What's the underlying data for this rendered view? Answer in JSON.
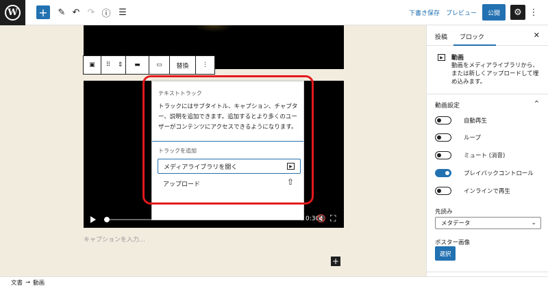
{
  "topbar": {
    "logo": "W",
    "icons": [
      "plus-icon",
      "pencil-icon",
      "undo-icon",
      "redo-icon",
      "info-icon",
      "list-view-icon",
      "gear-icon",
      "more-vertical-icon"
    ],
    "save_draft": "下書き保存",
    "preview": "プレビュー",
    "publish": "公開"
  },
  "block_toolbar": {
    "replace_label": "替換"
  },
  "video": {
    "time": "0:00 / 0:30"
  },
  "popover": {
    "heading": "テキストトラック",
    "description": "トラックにはサブタイトル、キャプション、チャプター、説明を追加できます。追加するとより多くのユーザーがコンテンツにアクセスできるようになります。",
    "add_track_label": "トラックを追加",
    "open_library": "メディアライブラリを開く",
    "upload": "アップロード"
  },
  "caption_placeholder": "キャプションを入力…",
  "sidebar": {
    "tabs": [
      "投稿",
      "ブロック"
    ],
    "active_tab": "ブロック",
    "block_name": "動画",
    "block_description": "動画をメディアライブラリから、または新しくアップロードして埋め込みます。",
    "panel_title": "動画設定",
    "toggles": [
      {
        "label": "自動再生",
        "on": false
      },
      {
        "label": "ループ",
        "on": false
      },
      {
        "label": "ミュート (消音)",
        "on": false
      },
      {
        "label": "プレイバックコントロール",
        "on": true
      },
      {
        "label": "インラインで再生",
        "on": false
      }
    ],
    "preload_label": "先読み",
    "preload_value": "メタデータ",
    "poster_label": "ポスター画像",
    "select_button": "選択"
  },
  "footer": {
    "crumb_1": "文書",
    "arrow": "→",
    "crumb_2": "動画"
  },
  "colors": {
    "accent": "#2271b1",
    "highlight": "#e3191c",
    "canvas_bg": "#f2ecdf"
  }
}
